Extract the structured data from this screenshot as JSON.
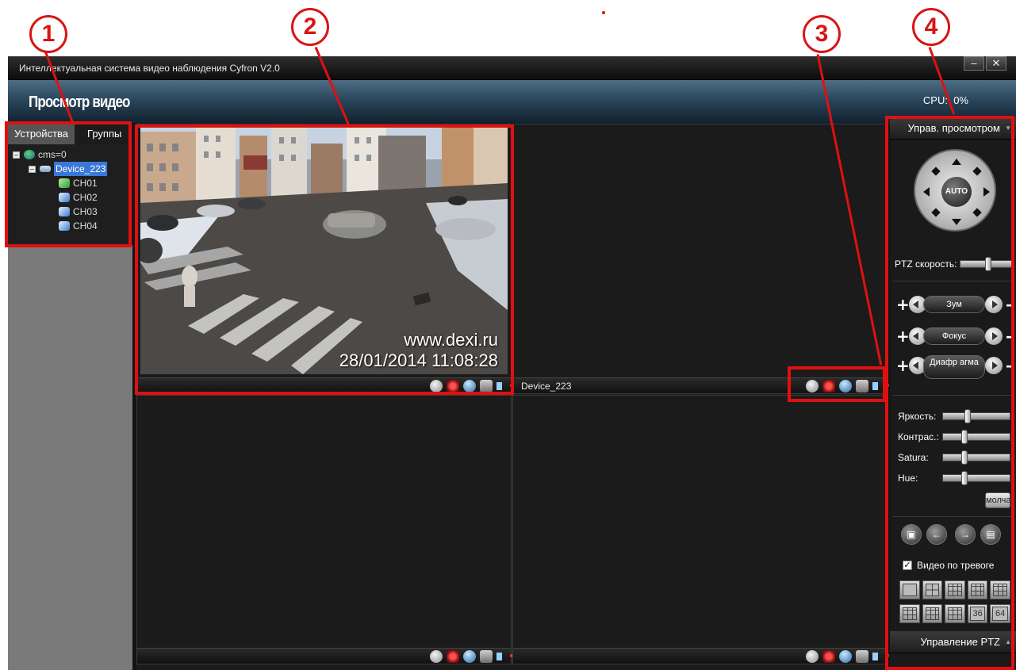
{
  "annotations": [
    "1",
    "2",
    "3",
    "4"
  ],
  "window": {
    "title": "Интеллектуальная система видео наблюдения Cyfron V2.0",
    "minimize": "–",
    "close": "✕"
  },
  "header": {
    "title": "Просмотр видео",
    "cpu_label": "CPU:",
    "cpu_value": "0%"
  },
  "left_panel": {
    "tabs": [
      "Устройства",
      "Группы"
    ],
    "tree": {
      "root": "cms=0",
      "device": "Device_223",
      "channels": [
        "CH01",
        "CH02",
        "CH03",
        "CH04"
      ]
    }
  },
  "video": {
    "panes": [
      {
        "name": ""
      },
      {
        "name": "Device_223"
      },
      {
        "name": ""
      },
      {
        "name": ""
      }
    ],
    "osd_site": "www.dexi.ru",
    "osd_time": "28/01/2014 11:08:28"
  },
  "right_panel": {
    "view_control_header": "Управ. просмотром",
    "auto_button": "AUTO",
    "ptz_speed_label": "PTZ скорость:",
    "lens": [
      "Зум",
      "Фокус",
      "Диафр агма"
    ],
    "image_labels": [
      "Яркость:",
      "Контрас.:",
      "Satura:",
      "Hue:"
    ],
    "image_levels": [
      0.35,
      0.3,
      0.3,
      0.3
    ],
    "ptz_speed_level": 0.55,
    "default_button": "молча",
    "alarm_video_label": "Видео по тревоге",
    "alarm_video_checked": true,
    "layout_labels": [
      "36",
      "64"
    ],
    "ptz_control_header": "Управление PTZ"
  }
}
